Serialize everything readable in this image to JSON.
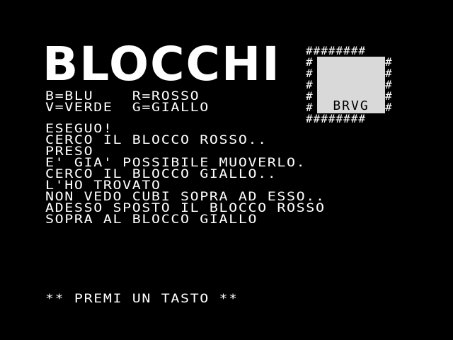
{
  "title": "BLOCCHI",
  "legend": {
    "row1": "B=BLU    R=ROSSO",
    "row2": "V=VERDE  G=GIALLO"
  },
  "block_graphic": {
    "border_row": "########",
    "label": "BRVG"
  },
  "log": [
    "ESEGUO!",
    "CERCO IL BLOCCO ROSSO..",
    "PRESO",
    "E' GIA' POSSIBILE MUOVERLO.",
    "CERCO IL BLOCCO GIALLO..",
    "L'HO TROVATO",
    "NON VEDO CUBI SOPRA AD ESSO..",
    "ADESSO SPOSTO IL BLOCCO ROSSO",
    "SOPRA AL BLOCCO GIALLO"
  ],
  "prompt": "** PREMI UN TASTO **"
}
